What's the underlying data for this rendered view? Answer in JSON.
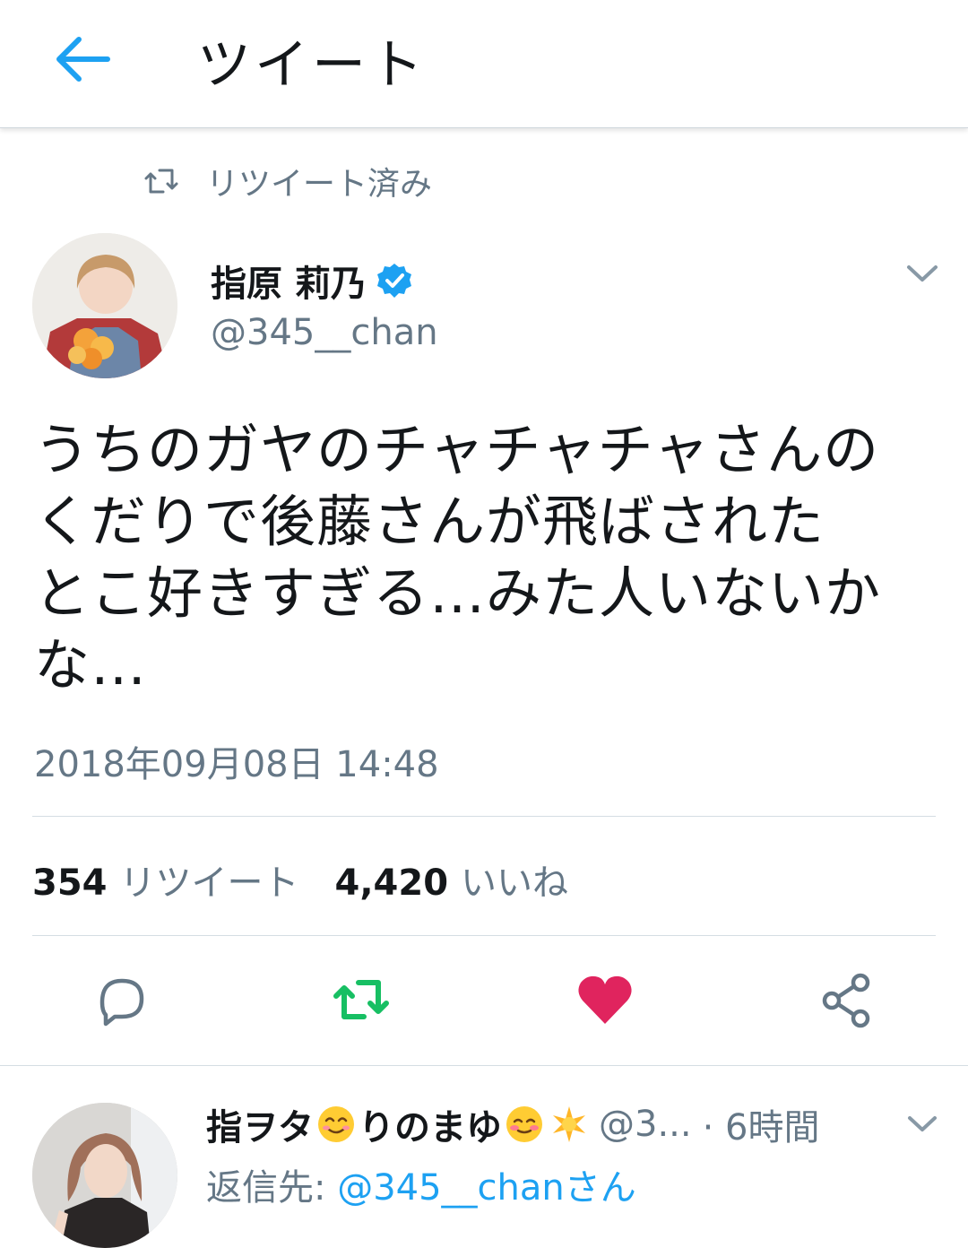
{
  "header": {
    "title": "ツイート",
    "back_icon": "arrow-left-icon"
  },
  "retweet_banner": {
    "label": "リツイート済み",
    "icon": "retweet-icon"
  },
  "tweet": {
    "display_name": "指原 莉乃",
    "handle": "@345__chan",
    "text_lines": [
      "うちのガヤのチャチャチャさんの",
      "くだりで後藤さんが飛ばされた",
      "とこ好きすぎる…みた人いないか",
      "な…"
    ],
    "timestamp": "2018年09月08日 14:48",
    "retweet_count": "354",
    "retweet_label": "リツイート",
    "like_count": "4,420",
    "like_label": "いいね",
    "liked": true,
    "retweeted": true
  },
  "reply": {
    "name_part1": "指ヲタ",
    "name_part2": "りのまゆ",
    "handle": "@3...",
    "time": "· 6時間",
    "reply_prefix": "返信先: ",
    "reply_to": "@345__chanさん"
  },
  "colors": {
    "accent": "#1da1f2",
    "retweet_green": "#17bf63",
    "like_red": "#e0245e",
    "secondary_text": "#657786"
  }
}
